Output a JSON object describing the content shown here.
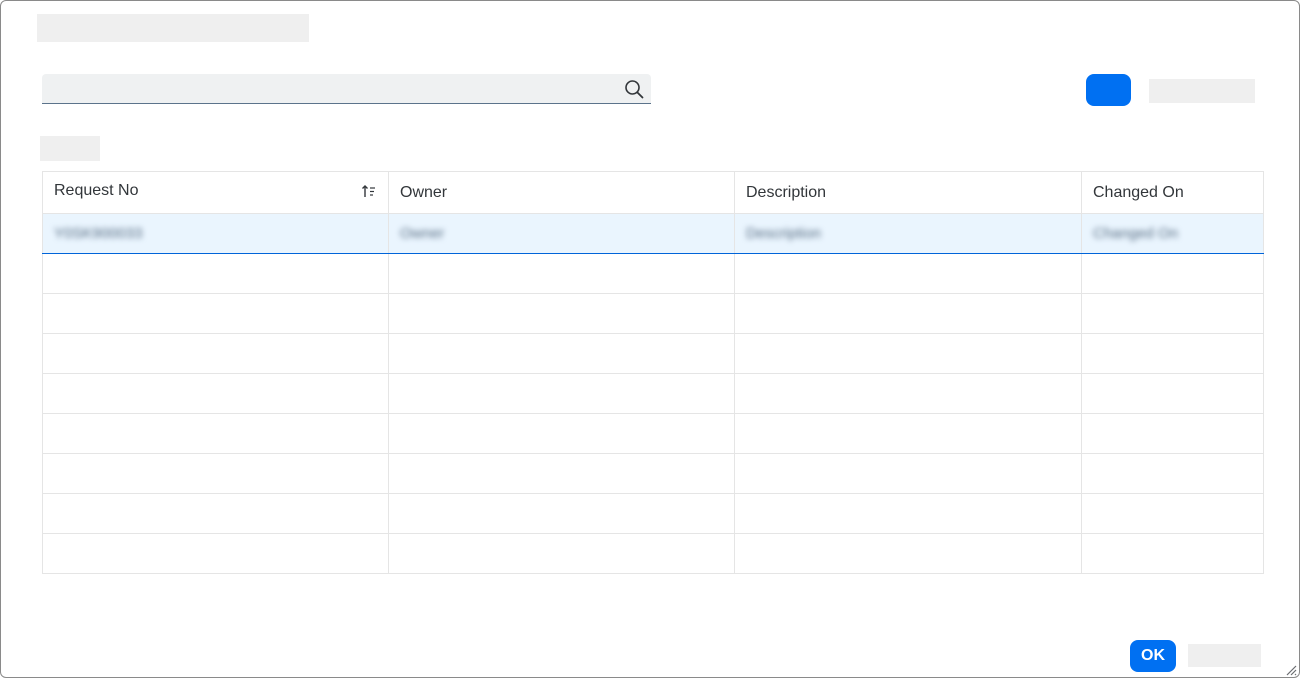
{
  "search": {
    "value": "",
    "placeholder": ""
  },
  "table": {
    "columns": [
      {
        "label": "Request No"
      },
      {
        "label": "Owner"
      },
      {
        "label": "Description"
      },
      {
        "label": "Changed On"
      }
    ],
    "rows": [
      {
        "request_no": "Y0SK900033",
        "owner": "Owner",
        "description": "Description",
        "changed_on": "Changed On"
      }
    ]
  },
  "footer": {
    "ok_label": "OK"
  },
  "colors": {
    "accent": "#0070f2",
    "selected_row": "#eaf5fe",
    "text": "#32363a"
  }
}
